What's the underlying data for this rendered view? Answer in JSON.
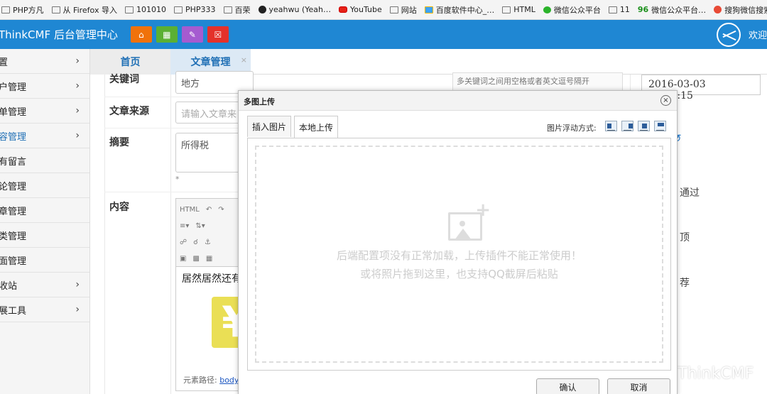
{
  "bookmarks": [
    {
      "label": "PHP方凡",
      "icon": "folder"
    },
    {
      "label": "从 Firefox 导入",
      "icon": "folder"
    },
    {
      "label": "101010",
      "icon": "folder"
    },
    {
      "label": "PHP333",
      "icon": "folder"
    },
    {
      "label": "百荣",
      "icon": "folder"
    },
    {
      "label": "yeahwu (Yeah…",
      "icon": "github"
    },
    {
      "label": "YouTube",
      "icon": "youtube"
    },
    {
      "label": "网站",
      "icon": "folder"
    },
    {
      "label": "百度软件中心_…",
      "icon": "baidu"
    },
    {
      "label": "HTML",
      "icon": "folder"
    },
    {
      "label": "微信公众平台",
      "icon": "wechat"
    },
    {
      "label": "11",
      "icon": "folder"
    },
    {
      "label": "微信公众平台…",
      "icon": "96"
    },
    {
      "label": "搜狗微信搜索_",
      "icon": "sogou"
    }
  ],
  "header": {
    "brand": "ThinkCMF 后台管理中心",
    "welcome": "欢迎"
  },
  "sidebar": {
    "items": [
      {
        "label": "置",
        "chevron": true
      },
      {
        "label": "户管理",
        "chevron": true
      },
      {
        "label": "单管理",
        "chevron": true
      },
      {
        "label": "容管理",
        "chevron": true,
        "active": true
      },
      {
        "label": "有留言",
        "chevron": false
      },
      {
        "label": "论管理",
        "chevron": false
      },
      {
        "label": "章管理",
        "chevron": false
      },
      {
        "label": "类管理",
        "chevron": false
      },
      {
        "label": "面管理",
        "chevron": false
      },
      {
        "label": "收站",
        "chevron": true
      },
      {
        "label": "展工具",
        "chevron": true
      }
    ],
    "chevron_glyph": "›"
  },
  "tabs": {
    "home": "首页",
    "current": "文章管理",
    "close": "×"
  },
  "form": {
    "keywords_label": "关键词",
    "keywords_value": "地方",
    "keywords_hint": "多关键词之间用空格或者英文逗号隔开",
    "source_label": "文章来源",
    "source_placeholder": "请输入文章来",
    "summary_label": "摘要",
    "summary_value": "所得税",
    "summary_star": "*",
    "content_label": "内容",
    "content_text": "居然居然还有",
    "path_label": "元素路径:",
    "path_link": "body",
    "date": "2016-03-03 00:27:15",
    "right_labels": [
      "通过",
      "顶",
      "荐"
    ],
    "editor_html_label": "HTML"
  },
  "footer_brand": "ThinkCMF",
  "modal": {
    "title": "多图上传",
    "close": "×",
    "tab_insert": "插入图片",
    "tab_local": "本地上传",
    "float_label": "图片浮动方式:",
    "message_line1": "后端配置项没有正常加载，上传插件不能正常使用！",
    "message_line2": "或将照片拖到这里，也支持QQ截屏后粘贴",
    "confirm": "确认",
    "cancel": "取消"
  },
  "colors": {
    "header": "#1f87d3",
    "btn_home": "#f0720a",
    "btn_grid": "#5bb033",
    "btn_edit": "#a55bd0",
    "btn_trash": "#e4312a"
  }
}
